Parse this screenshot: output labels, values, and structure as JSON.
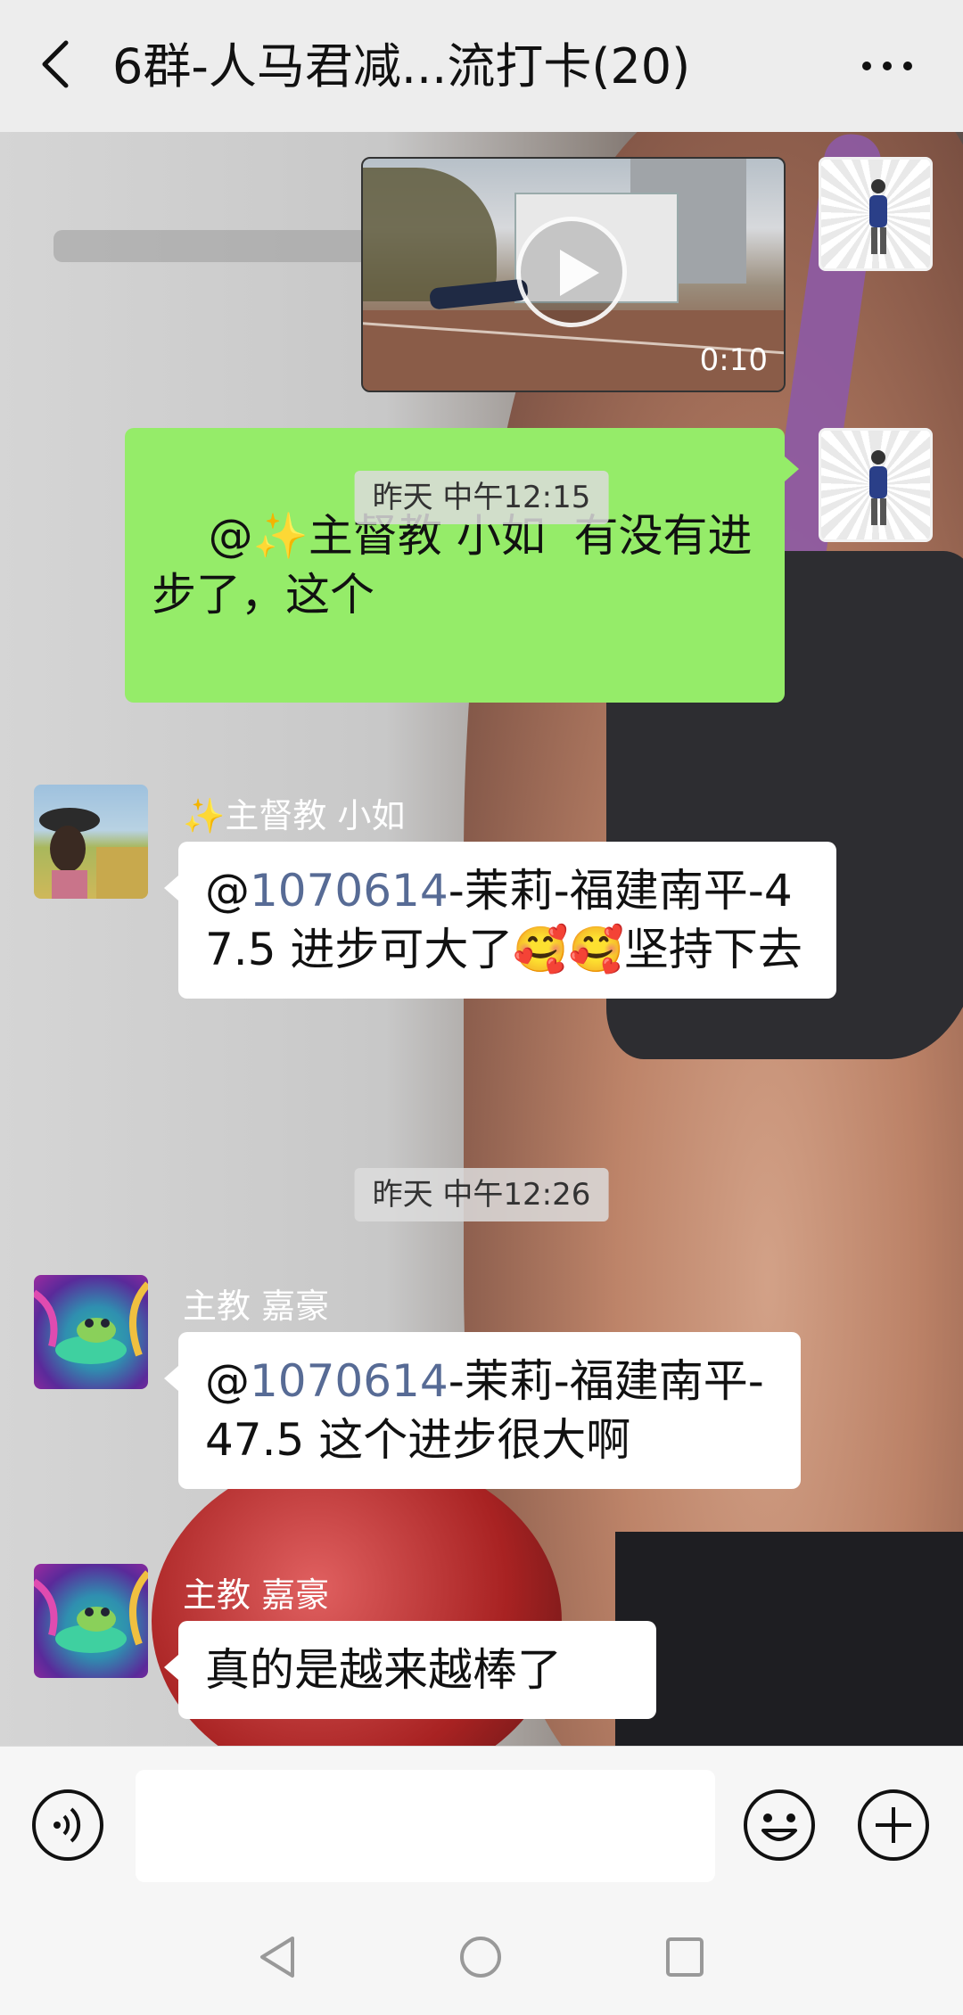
{
  "header": {
    "title": "6群-人马君减...流打卡(20)"
  },
  "video": {
    "duration": "0:10"
  },
  "messages": {
    "m1": {
      "prefix": "@",
      "sparkle": "✨",
      "text": "主督教 小如  有没有进步了，这个"
    },
    "ts1": "昨天 中午12:15",
    "m2": {
      "sender_sparkle": "✨",
      "sender": "主督教 小如",
      "prefix": "@",
      "mention": "1070614",
      "text": "-茉莉-福建南平-47.5 进步可大了🥰🥰坚持下去"
    },
    "ts2": "昨天 中午12:26",
    "m3": {
      "sender": "主教 嘉豪",
      "prefix": "@",
      "mention": "1070614",
      "text": "-茉莉-福建南平-47.5 这个进步很大啊"
    },
    "m4": {
      "sender": "主教 嘉豪",
      "text": "真的是越来越棒了"
    }
  },
  "input": {
    "value": ""
  },
  "icons": {
    "back": "back-arrow-icon",
    "more": "more-dots-icon",
    "voice": "voice-icon",
    "emoji": "emoji-icon",
    "plus": "plus-icon"
  },
  "colors": {
    "green_bubble": "#95ec69",
    "mention": "#576b95"
  }
}
